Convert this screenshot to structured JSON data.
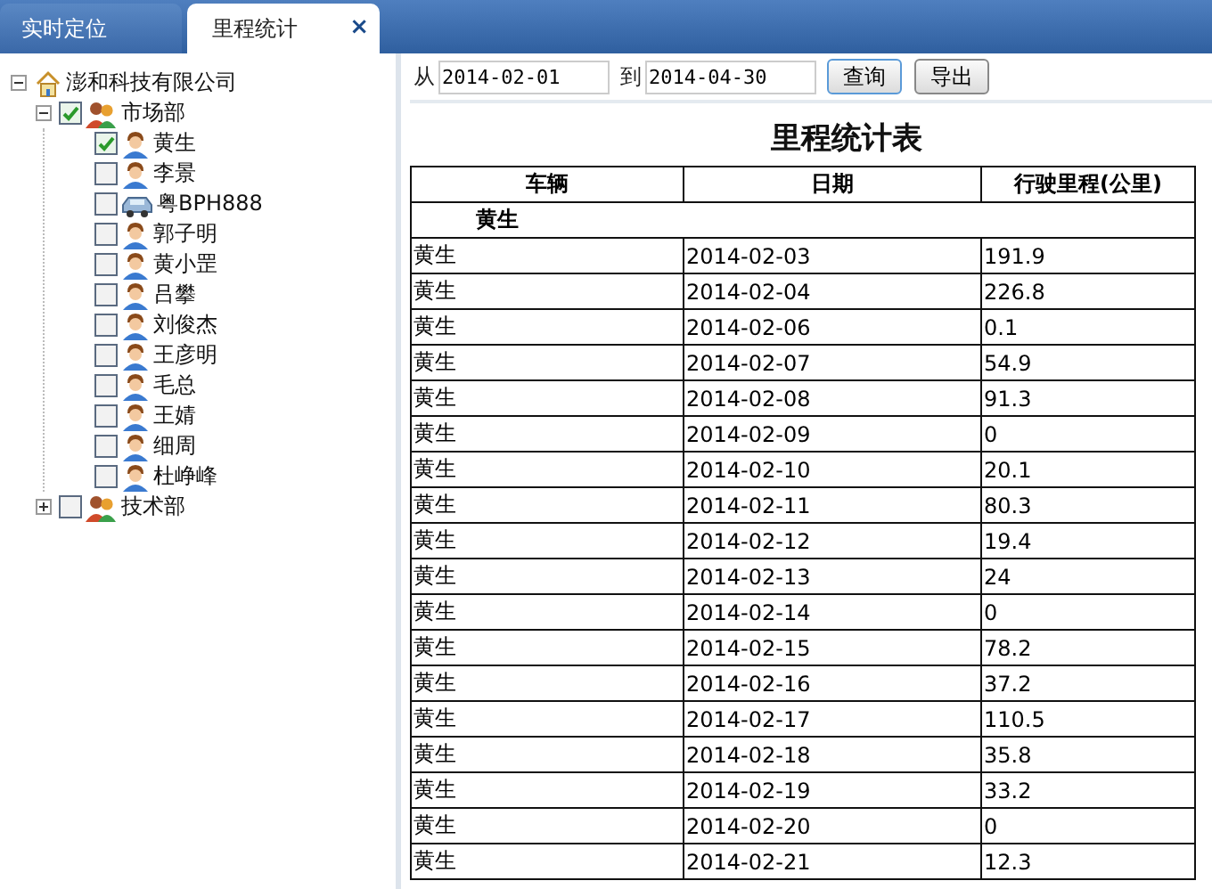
{
  "tabs": [
    {
      "label": "实时定位",
      "selected": false
    },
    {
      "label": "里程统计",
      "selected": true,
      "close": "×"
    }
  ],
  "tree": {
    "label": "澎和科技有限公司",
    "expanded": true,
    "children": [
      {
        "label": "市场部",
        "expanded": true,
        "checked": true,
        "children": [
          {
            "label": "黄生",
            "kind": "person",
            "checked": true
          },
          {
            "label": "李景",
            "kind": "person",
            "checked": false
          },
          {
            "label": "粤BPH888",
            "kind": "vehicle",
            "checked": false
          },
          {
            "label": "郭子明",
            "kind": "person",
            "checked": false
          },
          {
            "label": "黄小罡",
            "kind": "person",
            "checked": false
          },
          {
            "label": "吕攀",
            "kind": "person",
            "checked": false
          },
          {
            "label": "刘俊杰",
            "kind": "person",
            "checked": false
          },
          {
            "label": "王彦明",
            "kind": "person",
            "checked": false
          },
          {
            "label": "毛总",
            "kind": "person",
            "checked": false
          },
          {
            "label": "王婧",
            "kind": "person",
            "checked": false
          },
          {
            "label": "细周",
            "kind": "person",
            "checked": false
          },
          {
            "label": "杜峥峰",
            "kind": "person",
            "checked": false
          }
        ]
      },
      {
        "label": "技术部",
        "expanded": false,
        "checked": false
      }
    ]
  },
  "filter": {
    "from_label": "从",
    "from_value": "2014-02-01",
    "to_label": "到",
    "to_value": "2014-04-30",
    "buttons": [
      "查询",
      "导出"
    ]
  },
  "report": {
    "title": "里程统计表",
    "columns": [
      "车辆",
      "日期",
      "行驶里程(公里)"
    ],
    "group": "黄生",
    "rows": [
      [
        "黄生",
        "2014-02-03",
        "191.9"
      ],
      [
        "黄生",
        "2014-02-04",
        "226.8"
      ],
      [
        "黄生",
        "2014-02-06",
        "0.1"
      ],
      [
        "黄生",
        "2014-02-07",
        "54.9"
      ],
      [
        "黄生",
        "2014-02-08",
        "91.3"
      ],
      [
        "黄生",
        "2014-02-09",
        "0"
      ],
      [
        "黄生",
        "2014-02-10",
        "20.1"
      ],
      [
        "黄生",
        "2014-02-11",
        "80.3"
      ],
      [
        "黄生",
        "2014-02-12",
        "19.4"
      ],
      [
        "黄生",
        "2014-02-13",
        "24"
      ],
      [
        "黄生",
        "2014-02-14",
        "0"
      ],
      [
        "黄生",
        "2014-02-15",
        "78.2"
      ],
      [
        "黄生",
        "2014-02-16",
        "37.2"
      ],
      [
        "黄生",
        "2014-02-17",
        "110.5"
      ],
      [
        "黄生",
        "2014-02-18",
        "35.8"
      ],
      [
        "黄生",
        "2014-02-19",
        "33.2"
      ],
      [
        "黄生",
        "2014-02-20",
        "0"
      ],
      [
        "黄生",
        "2014-02-21",
        "12.3"
      ]
    ]
  }
}
